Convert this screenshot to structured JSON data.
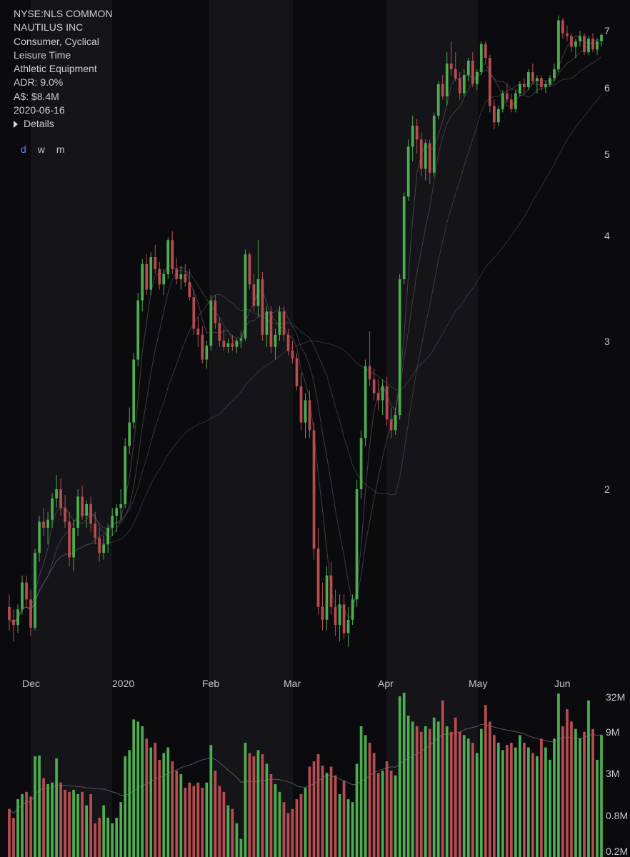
{
  "info": {
    "symbol": "NYSE:NLS COMMON",
    "company": "NAUTILUS INC",
    "sector": "Consumer, Cyclical",
    "industry": "Leisure Time",
    "subindustry": "Athletic Equipment",
    "adr": "ADR: 9.0%",
    "dollar_volume": "A$: $8.4M",
    "date": "2020-06-16",
    "details_label": "Details"
  },
  "timeframes": [
    {
      "label": "d",
      "active": true
    },
    {
      "label": "w",
      "active": false
    },
    {
      "label": "m",
      "active": false
    }
  ],
  "colors": {
    "up": "#4cae4f",
    "down": "#b84d50",
    "background": "#0b0b0f",
    "band": "#141419",
    "moving_average": "#6a6a72",
    "active_timeframe": "#5a8dee"
  },
  "chart_data": {
    "type": "candlestick",
    "price_scale": "log",
    "volume_scale": "log",
    "price_ticks": [
      "7",
      "6",
      "5",
      "4",
      "3",
      "2"
    ],
    "volume_ticks": [
      "32M",
      "9M",
      "3M",
      "0.8M",
      "0.2M"
    ],
    "month_labels": [
      "Dec",
      "2020",
      "Feb",
      "Mar",
      "Apr",
      "May",
      "Jun"
    ],
    "grid": false,
    "candles": [
      [
        1.45,
        1.5,
        1.36,
        1.4,
        0.8
      ],
      [
        1.4,
        1.44,
        1.32,
        1.38,
        0.6
      ],
      [
        1.38,
        1.46,
        1.35,
        1.44,
        1.1
      ],
      [
        1.44,
        1.58,
        1.42,
        1.55,
        1.3
      ],
      [
        1.55,
        1.58,
        1.45,
        1.48,
        1.4
      ],
      [
        1.48,
        1.52,
        1.34,
        1.37,
        1.2
      ],
      [
        1.37,
        1.7,
        1.36,
        1.68,
        4.5
      ],
      [
        1.68,
        1.86,
        1.64,
        1.83,
        4.6
      ],
      [
        1.83,
        1.9,
        1.76,
        1.8,
        2.2
      ],
      [
        1.8,
        1.88,
        1.72,
        1.84,
        1.8
      ],
      [
        1.84,
        1.98,
        1.8,
        1.95,
        1.9
      ],
      [
        1.95,
        2.08,
        1.9,
        2.0,
        4.2
      ],
      [
        2.0,
        2.06,
        1.86,
        1.9,
        1.9
      ],
      [
        1.9,
        1.97,
        1.8,
        1.83,
        1.5
      ],
      [
        1.83,
        1.88,
        1.62,
        1.66,
        1.4
      ],
      [
        1.66,
        1.84,
        1.6,
        1.8,
        1.5
      ],
      [
        1.8,
        2.0,
        1.76,
        1.96,
        1.3
      ],
      [
        1.96,
        2.02,
        1.84,
        1.86,
        1.4
      ],
      [
        1.86,
        1.94,
        1.8,
        1.92,
        0.9
      ],
      [
        1.92,
        1.96,
        1.78,
        1.82,
        1.3
      ],
      [
        1.82,
        1.88,
        1.72,
        1.75,
        0.5
      ],
      [
        1.75,
        1.8,
        1.64,
        1.68,
        0.6
      ],
      [
        1.68,
        1.76,
        1.65,
        1.72,
        0.9
      ],
      [
        1.72,
        1.82,
        1.68,
        1.8,
        0.6
      ],
      [
        1.8,
        1.9,
        1.76,
        1.86,
        0.5
      ],
      [
        1.86,
        1.92,
        1.78,
        1.9,
        0.6
      ],
      [
        1.9,
        2.0,
        1.84,
        1.92,
        1.0
      ],
      [
        1.92,
        2.3,
        1.9,
        2.25,
        4.5
      ],
      [
        2.25,
        2.5,
        2.2,
        2.4,
        5.5
      ],
      [
        2.4,
        2.9,
        2.36,
        2.85,
        15
      ],
      [
        2.85,
        3.42,
        2.8,
        3.35,
        14
      ],
      [
        3.35,
        3.75,
        3.25,
        3.7,
        12
      ],
      [
        3.7,
        3.8,
        3.4,
        3.45,
        8
      ],
      [
        3.45,
        3.82,
        3.4,
        3.77,
        6
      ],
      [
        3.77,
        3.9,
        3.6,
        3.65,
        7
      ],
      [
        3.65,
        3.72,
        3.45,
        3.5,
        4
      ],
      [
        3.5,
        3.65,
        3.4,
        3.6,
        5
      ],
      [
        3.6,
        3.98,
        3.55,
        3.95,
        6
      ],
      [
        3.95,
        4.05,
        3.6,
        3.65,
        3.8
      ],
      [
        3.65,
        3.76,
        3.5,
        3.55,
        2.8
      ],
      [
        3.55,
        3.68,
        3.45,
        3.6,
        2.5
      ],
      [
        3.6,
        3.7,
        3.48,
        3.52,
        1.6
      ],
      [
        3.52,
        3.65,
        3.35,
        3.38,
        1.9
      ],
      [
        3.38,
        3.45,
        3.05,
        3.1,
        1.7
      ],
      [
        3.1,
        3.2,
        2.95,
        3.05,
        1.9
      ],
      [
        3.05,
        3.12,
        2.82,
        2.85,
        1.6
      ],
      [
        2.85,
        3.0,
        2.78,
        2.96,
        1.9
      ],
      [
        2.96,
        3.4,
        2.92,
        3.35,
        6.5
      ],
      [
        3.35,
        3.4,
        3.1,
        3.15,
        2.8
      ],
      [
        3.15,
        3.2,
        2.95,
        3.0,
        1.7
      ],
      [
        3.0,
        3.1,
        2.92,
        2.95,
        1.4
      ],
      [
        2.95,
        3.02,
        2.9,
        2.98,
        0.9
      ],
      [
        2.98,
        3.05,
        2.92,
        2.95,
        0.8
      ],
      [
        2.95,
        3.02,
        2.9,
        3.0,
        0.5
      ],
      [
        3.0,
        3.08,
        2.94,
        3.02,
        0.3
      ],
      [
        3.02,
        3.85,
        3.0,
        3.8,
        7
      ],
      [
        3.8,
        3.82,
        3.45,
        3.5,
        5
      ],
      [
        3.5,
        3.6,
        3.25,
        3.3,
        4.5
      ],
      [
        3.3,
        3.95,
        3.2,
        3.55,
        5.5
      ],
      [
        3.55,
        3.62,
        3.0,
        3.05,
        4.8
      ],
      [
        3.05,
        3.3,
        2.95,
        3.25,
        3.5
      ],
      [
        3.25,
        3.3,
        2.9,
        2.95,
        2.5
      ],
      [
        2.95,
        3.1,
        2.85,
        3.05,
        1.8
      ],
      [
        3.05,
        3.3,
        3.0,
        3.25,
        1.4
      ],
      [
        3.25,
        3.3,
        3.0,
        3.05,
        1.0
      ],
      [
        3.05,
        3.1,
        2.88,
        2.92,
        0.7
      ],
      [
        2.92,
        3.0,
        2.82,
        2.86,
        0.8
      ],
      [
        2.86,
        2.9,
        2.62,
        2.65,
        1.1
      ],
      [
        2.65,
        2.75,
        2.35,
        2.4,
        1.3
      ],
      [
        2.4,
        2.6,
        2.3,
        2.55,
        1.6
      ],
      [
        2.55,
        2.62,
        2.3,
        2.35,
        3.2
      ],
      [
        2.35,
        2.4,
        1.65,
        1.7,
        3.8
      ],
      [
        1.7,
        1.8,
        1.42,
        1.45,
        4.8
      ],
      [
        1.45,
        1.55,
        1.36,
        1.4,
        3.3
      ],
      [
        1.4,
        1.62,
        1.36,
        1.58,
        2.6
      ],
      [
        1.58,
        1.64,
        1.42,
        1.45,
        3.2
      ],
      [
        1.45,
        1.52,
        1.34,
        1.38,
        2.4
      ],
      [
        1.38,
        1.5,
        1.32,
        1.46,
        1.3
      ],
      [
        1.46,
        1.5,
        1.33,
        1.35,
        2.0
      ],
      [
        1.35,
        1.45,
        1.3,
        1.4,
        1.1
      ],
      [
        1.4,
        1.5,
        1.38,
        1.48,
        1.0
      ],
      [
        1.48,
        2.05,
        1.45,
        2.0,
        3.5
      ],
      [
        2.0,
        2.35,
        1.95,
        2.3,
        12
      ],
      [
        2.3,
        2.85,
        2.25,
        2.8,
        9
      ],
      [
        2.8,
        3.08,
        2.65,
        2.7,
        7
      ],
      [
        2.7,
        2.78,
        2.55,
        2.6,
        5
      ],
      [
        2.6,
        2.7,
        2.48,
        2.55,
        2.6
      ],
      [
        2.55,
        2.7,
        2.45,
        2.65,
        2.8
      ],
      [
        2.65,
        2.72,
        2.38,
        2.42,
        3.8
      ],
      [
        2.42,
        2.5,
        2.3,
        2.35,
        2.8
      ],
      [
        2.35,
        2.5,
        2.32,
        2.45,
        2.4
      ],
      [
        2.45,
        3.6,
        2.42,
        3.55,
        32
      ],
      [
        3.55,
        4.5,
        3.5,
        4.45,
        36
      ],
      [
        4.45,
        5.2,
        4.4,
        5.1,
        17
      ],
      [
        5.1,
        5.55,
        4.9,
        5.4,
        14
      ],
      [
        5.4,
        5.5,
        5.0,
        5.2,
        12
      ],
      [
        5.2,
        5.3,
        4.7,
        4.8,
        10
      ],
      [
        4.8,
        5.2,
        4.65,
        5.15,
        12
      ],
      [
        5.15,
        5.2,
        4.6,
        4.75,
        11
      ],
      [
        4.75,
        5.6,
        4.7,
        5.55,
        16
      ],
      [
        5.55,
        6.1,
        5.5,
        6.05,
        14
      ],
      [
        6.05,
        6.2,
        5.8,
        5.85,
        28
      ],
      [
        5.85,
        6.6,
        5.7,
        6.4,
        12
      ],
      [
        6.4,
        6.8,
        6.2,
        6.3,
        10
      ],
      [
        6.3,
        6.6,
        6.1,
        6.15,
        16
      ],
      [
        6.15,
        6.25,
        5.8,
        5.9,
        10
      ],
      [
        5.9,
        6.3,
        5.85,
        6.2,
        9
      ],
      [
        6.2,
        6.5,
        6.1,
        6.45,
        8
      ],
      [
        6.45,
        6.6,
        6.0,
        6.05,
        7
      ],
      [
        6.05,
        6.3,
        5.95,
        6.25,
        5
      ],
      [
        6.25,
        6.8,
        6.2,
        6.75,
        11
      ],
      [
        6.75,
        6.8,
        6.4,
        6.5,
        24
      ],
      [
        6.5,
        6.55,
        5.6,
        5.7,
        14
      ],
      [
        5.7,
        5.8,
        5.35,
        5.45,
        9
      ],
      [
        5.45,
        5.7,
        5.4,
        5.65,
        7
      ],
      [
        5.65,
        5.95,
        5.6,
        5.9,
        5.5
      ],
      [
        5.9,
        6.05,
        5.75,
        5.8,
        6.5
      ],
      [
        5.8,
        5.9,
        5.6,
        5.65,
        7
      ],
      [
        5.65,
        5.95,
        5.6,
        5.9,
        6
      ],
      [
        5.9,
        6.1,
        5.85,
        6.05,
        9
      ],
      [
        6.05,
        6.15,
        5.9,
        6.0,
        7
      ],
      [
        6.0,
        6.3,
        5.95,
        6.25,
        6
      ],
      [
        6.25,
        6.4,
        6.05,
        6.1,
        5
      ],
      [
        6.1,
        6.2,
        5.9,
        6.15,
        4.5
      ],
      [
        6.15,
        6.2,
        5.95,
        6.0,
        8
      ],
      [
        6.0,
        6.1,
        5.9,
        6.05,
        6
      ],
      [
        6.05,
        6.2,
        6.0,
        6.15,
        4
      ],
      [
        6.15,
        6.4,
        6.1,
        6.3,
        8
      ],
      [
        6.3,
        7.3,
        6.25,
        7.2,
        35
      ],
      [
        7.2,
        7.25,
        6.85,
        6.95,
        12
      ],
      [
        6.95,
        7.1,
        6.8,
        6.9,
        21
      ],
      [
        6.9,
        6.95,
        6.6,
        6.7,
        14
      ],
      [
        6.7,
        6.85,
        6.5,
        6.8,
        11
      ],
      [
        6.8,
        7.0,
        6.7,
        6.9,
        8
      ],
      [
        6.9,
        6.95,
        6.55,
        6.6,
        10
      ],
      [
        6.6,
        6.9,
        6.55,
        6.85,
        28
      ],
      [
        6.85,
        6.95,
        6.6,
        6.65,
        11
      ],
      [
        6.65,
        6.85,
        6.55,
        6.8,
        4
      ],
      [
        6.8,
        6.95,
        6.7,
        6.92,
        9
      ]
    ]
  }
}
